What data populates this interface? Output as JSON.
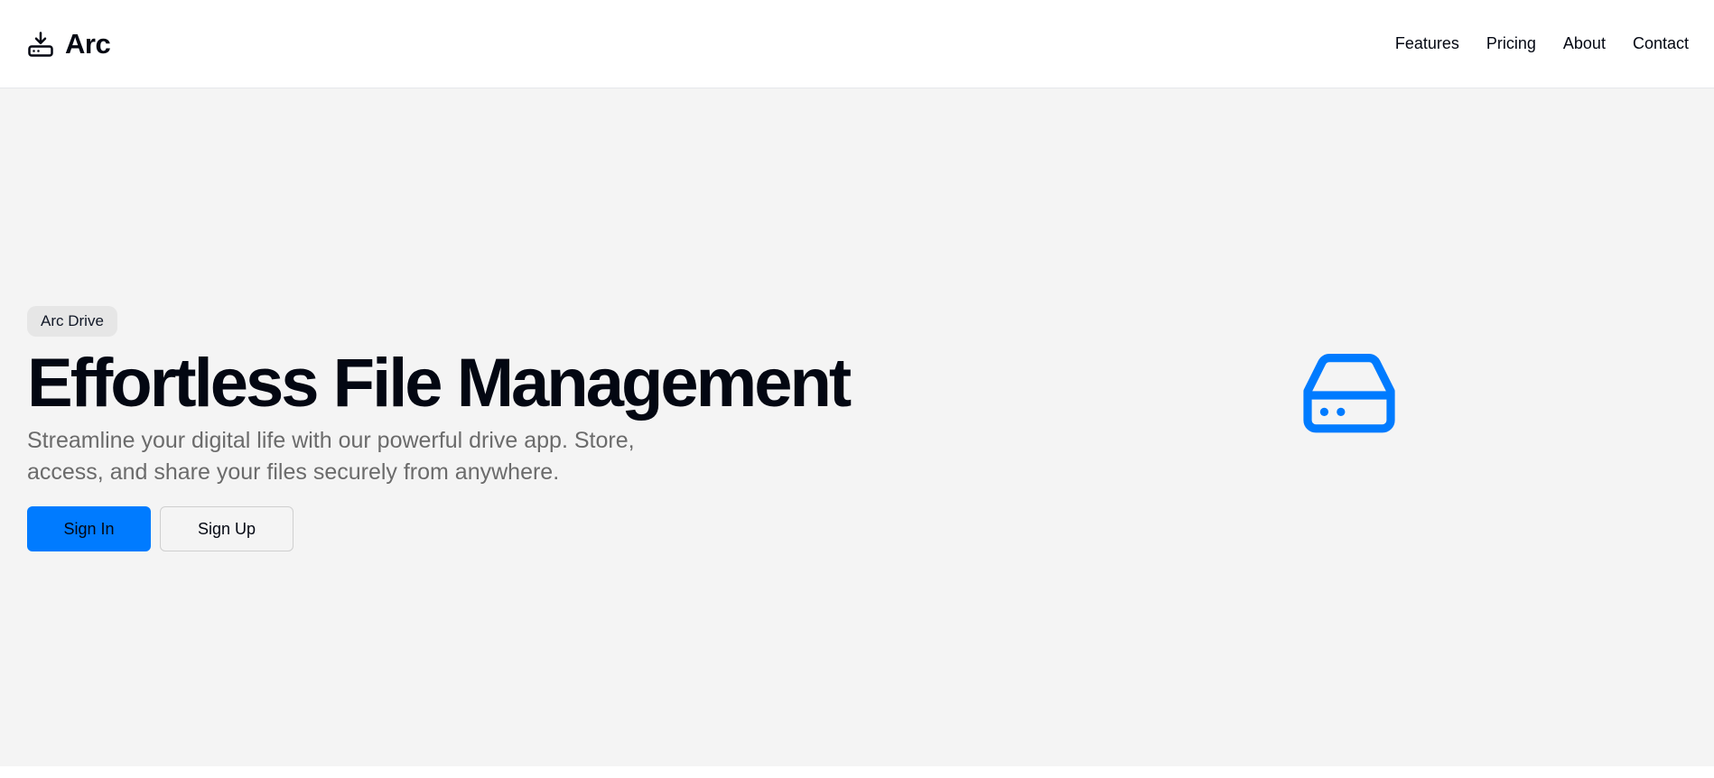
{
  "header": {
    "brand_name": "Arc",
    "brand_icon": "drive-download-icon",
    "nav": [
      {
        "label": "Features"
      },
      {
        "label": "Pricing"
      },
      {
        "label": "About"
      },
      {
        "label": "Contact"
      }
    ]
  },
  "hero": {
    "badge": "Arc Drive",
    "title": "Effortless File Management",
    "subtitle": "Streamline your digital life with our powerful drive app. Store, access, and share your files securely from anywhere.",
    "primary_button": "Sign In",
    "secondary_button": "Sign Up",
    "illustration_icon": "hard-drive-icon",
    "accent_color": "#007bff"
  }
}
